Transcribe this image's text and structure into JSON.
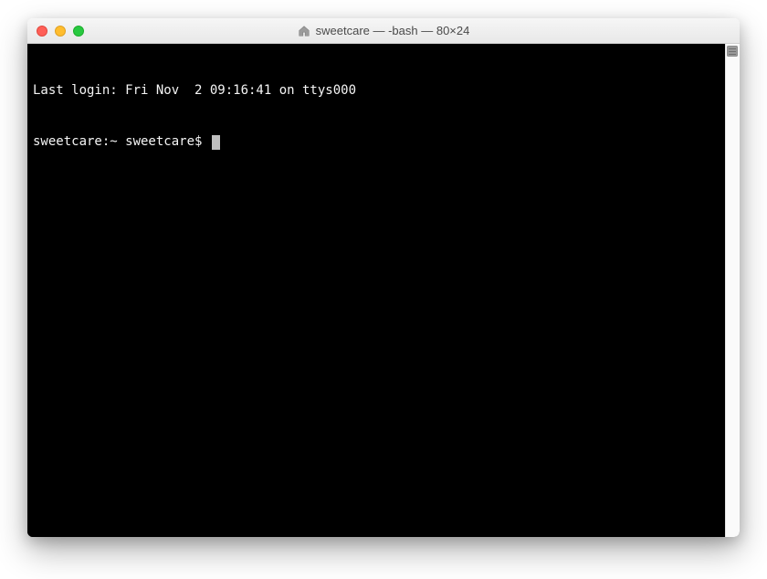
{
  "window": {
    "title": "sweetcare — -bash — 80×24",
    "icon": "home-icon"
  },
  "traffic_lights": {
    "close": "close",
    "minimize": "minimize",
    "maximize": "maximize"
  },
  "terminal": {
    "last_login_line": "Last login: Fri Nov  2 09:16:41 on ttys000",
    "prompt": "sweetcare:~ sweetcare$ "
  }
}
